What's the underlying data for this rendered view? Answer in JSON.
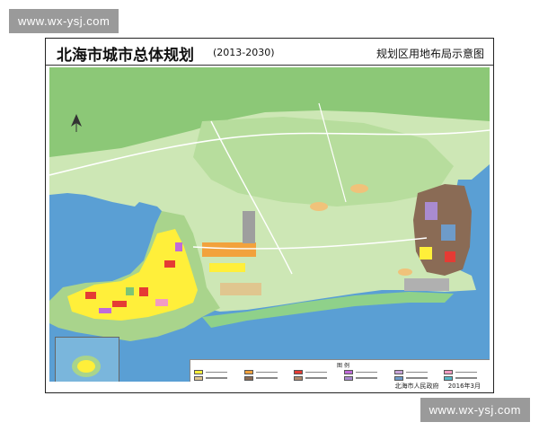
{
  "watermark": {
    "text": "www.wx-ysj.com"
  },
  "map": {
    "title": "北海市城市总体规划",
    "years": "(2013-2030)",
    "subtitle": "规划区用地布局示意图",
    "legend_title": "图 例",
    "footer_org": "北海市人民政府",
    "footer_date": "2016年3月"
  },
  "colors": {
    "sea": "#5a9fd4",
    "land_light": "#cde7b5",
    "land_mid": "#a9d48c",
    "land_dark": "#6fb55c",
    "residential": "#ffef3a",
    "commercial": "#e53b34",
    "industrial": "#8a6b55",
    "green": "#7cc576",
    "logistics": "#a98bd0",
    "coastal_green": "#8fd18a",
    "road": "#ffffff"
  },
  "legend": {
    "swatches": [
      "#ffef3a",
      "#f2a23c",
      "#e53b34",
      "#c06bd9",
      "#c7a3d8",
      "#f29bc2",
      "#e0c68f",
      "#8a6b55",
      "#b08a6d",
      "#a98bd0",
      "#6e9bc9",
      "#57b8c9",
      "#7cc576",
      "#3c8d3f",
      "#b4e08e",
      "#dddddd",
      "#9e9e9e",
      "#ffffff",
      "#f6c0cb",
      "#d94f6e",
      "#4b7bd0",
      "#9fc7e8",
      "#c8e36b",
      "#e9e39a",
      "#f0d34a",
      "#7e57c2",
      "#5e3a2a",
      "#bcbcbc",
      "#aa4444",
      "#77c9a8",
      "#cfd7e8",
      "#e8d4b8",
      "#c6e8ff",
      "#ff9966",
      "#66aa88",
      "#ddaa33"
    ]
  }
}
